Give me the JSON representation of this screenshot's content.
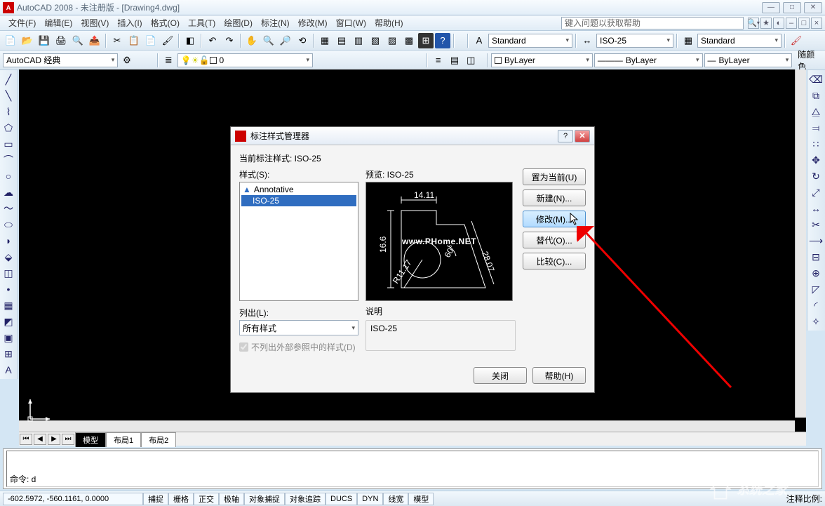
{
  "title": "AutoCAD 2008 - 未注册版 - [Drawing4.dwg]",
  "menu": [
    "文件(F)",
    "编辑(E)",
    "视图(V)",
    "插入(I)",
    "格式(O)",
    "工具(T)",
    "绘图(D)",
    "标注(N)",
    "修改(M)",
    "窗口(W)",
    "帮助(H)"
  ],
  "help_placeholder": "键入问题以获取帮助",
  "workspace_combo": "AutoCAD 经典",
  "layer_current": "0",
  "style_text": "Standard",
  "style_dim": "ISO-25",
  "style_tbl": "Standard",
  "prop_layer": "ByLayer",
  "prop_ltype": "ByLayer",
  "prop_lweight": "ByLayer",
  "prop_color_label": "随颜色",
  "tabs": {
    "model": "模型",
    "layout1": "布局1",
    "layout2": "布局2"
  },
  "cmd": "命令: d",
  "status": {
    "coords": "-602.5972, -560.1161, 0.0000",
    "toggles": [
      "捕捉",
      "栅格",
      "正交",
      "极轴",
      "对象捕捉",
      "对象追踪",
      "DUCS",
      "DYN",
      "线宽",
      "模型"
    ],
    "scale_label": "注释比例:"
  },
  "dialog": {
    "title": "标注样式管理器",
    "current_label": "当前标注样式: ISO-25",
    "styles_label": "样式(S):",
    "list": [
      "Annotative",
      "ISO-25"
    ],
    "selected": "ISO-25",
    "listout_label": "列出(L):",
    "listout_value": "所有样式",
    "xref_chk": "不列出外部参照中的样式(D)",
    "preview_label": "预览: ISO-25",
    "desc_label": "说明",
    "desc_value": "ISO-25",
    "btns": {
      "set_current": "置为当前(U)",
      "new": "新建(N)...",
      "modify": "修改(M)...",
      "override": "替代(O)...",
      "compare": "比较(C)..."
    },
    "close": "关闭",
    "help": "帮助(H)",
    "preview_dims": {
      "top": "14.11",
      "left": "16.6",
      "radius": "R11.17",
      "angle": "60°",
      "diag": "28.07"
    }
  },
  "watermark_center": "www.PHome.NET",
  "watermark_corner": "系统之家"
}
